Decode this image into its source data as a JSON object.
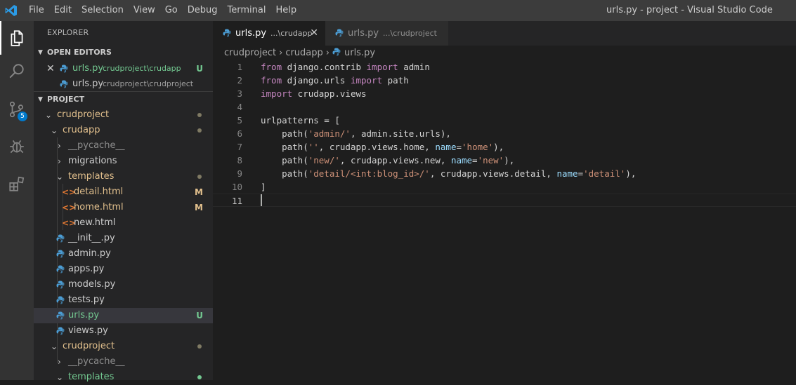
{
  "window": {
    "title": "urls.py - project - Visual Studio Code",
    "menu": [
      "File",
      "Edit",
      "Selection",
      "View",
      "Go",
      "Debug",
      "Terminal",
      "Help"
    ]
  },
  "activity_bar": {
    "items": [
      {
        "name": "explorer",
        "icon": "files-icon",
        "active": true
      },
      {
        "name": "search",
        "icon": "search-icon"
      },
      {
        "name": "source-control",
        "icon": "source-control-icon",
        "badge": "5"
      },
      {
        "name": "debug",
        "icon": "debug-icon"
      },
      {
        "name": "extensions",
        "icon": "extensions-icon"
      }
    ]
  },
  "sidebar": {
    "title": "EXPLORER",
    "open_editors": {
      "header": "OPEN EDITORS",
      "items": [
        {
          "name": "urls.py",
          "path": "crudproject\\crudapp",
          "status": "U"
        },
        {
          "name": "urls.py",
          "path": "crudproject\\crudproject",
          "status": ""
        }
      ]
    },
    "project": {
      "header": "PROJECT",
      "tree": [
        {
          "label": "crudproject",
          "type": "folder-open"
        },
        {
          "label": "crudapp",
          "type": "folder-open"
        },
        {
          "label": "__pycache__",
          "type": "folder"
        },
        {
          "label": "migrations",
          "type": "folder"
        },
        {
          "label": "templates",
          "type": "folder-open"
        },
        {
          "label": "detail.html",
          "type": "html",
          "status": "M"
        },
        {
          "label": "home.html",
          "type": "html",
          "status": "M"
        },
        {
          "label": "new.html",
          "type": "html"
        },
        {
          "label": "__init__.py",
          "type": "py"
        },
        {
          "label": "admin.py",
          "type": "py"
        },
        {
          "label": "apps.py",
          "type": "py"
        },
        {
          "label": "models.py",
          "type": "py"
        },
        {
          "label": "tests.py",
          "type": "py"
        },
        {
          "label": "urls.py",
          "type": "py",
          "status": "U"
        },
        {
          "label": "views.py",
          "type": "py"
        },
        {
          "label": "crudproject",
          "type": "folder-open"
        },
        {
          "label": "__pycache__",
          "type": "folder"
        },
        {
          "label": "templates",
          "type": "folder-open"
        }
      ]
    }
  },
  "tabs": [
    {
      "label": "urls.py",
      "dir": "...\\crudapp",
      "active": true
    },
    {
      "label": "urls.py",
      "dir": "...\\crudproject",
      "active": false
    }
  ],
  "breadcrumb": [
    "crudproject",
    "crudapp",
    "urls.py"
  ],
  "editor": {
    "line_numbers": [
      "1",
      "2",
      "3",
      "4",
      "5",
      "6",
      "7",
      "8",
      "9",
      "10",
      "11"
    ],
    "code": [
      "from django.contrib import admin",
      "from django.urls import path",
      "import crudapp.views",
      "",
      "urlpatterns = [",
      "    path('admin/', admin.site.urls),",
      "    path('', crudapp.views.home, name='home'),",
      "    path('new/', crudapp.views.new, name='new'),",
      "    path('detail/<int:blog_id>/', crudapp.views.detail, name='detail'),",
      "]",
      ""
    ]
  },
  "colors": {
    "keyword": "#c586c0",
    "string": "#ce9178",
    "parameter": "#9cdcfe",
    "untracked": "#73c991",
    "modified": "#e2c08d",
    "accent": "#007acc"
  }
}
